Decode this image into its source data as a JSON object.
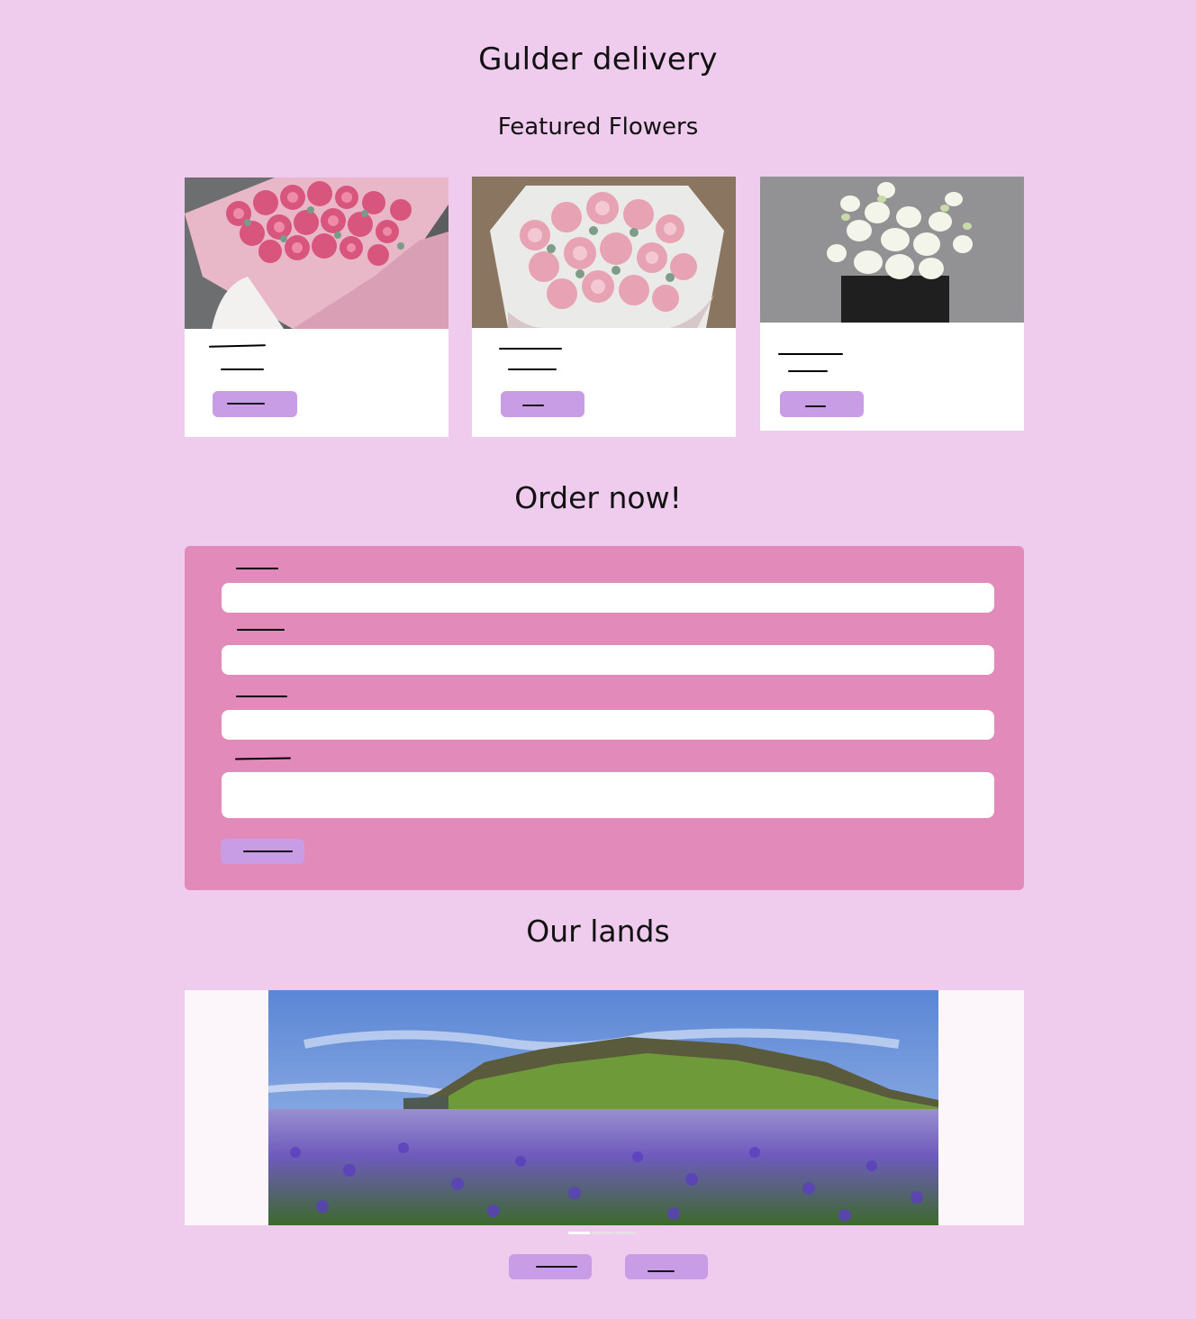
{
  "header": {
    "title": "Gulder delivery",
    "subtitle": "Featured Flowers"
  },
  "featured": {
    "cards": [
      {
        "image": "pink-peony-bouquet"
      },
      {
        "image": "pink-carnation-bouquet"
      },
      {
        "image": "white-gladiolus-bouquet"
      }
    ]
  },
  "order": {
    "heading": "Order now!"
  },
  "lands": {
    "heading": "Our lands",
    "image": "lupine-field-landscape"
  },
  "colors": {
    "page_bg": "#efcbee",
    "button": "#c99ce6",
    "form_panel": "#e28ab9",
    "card_bg": "#ffffff"
  }
}
